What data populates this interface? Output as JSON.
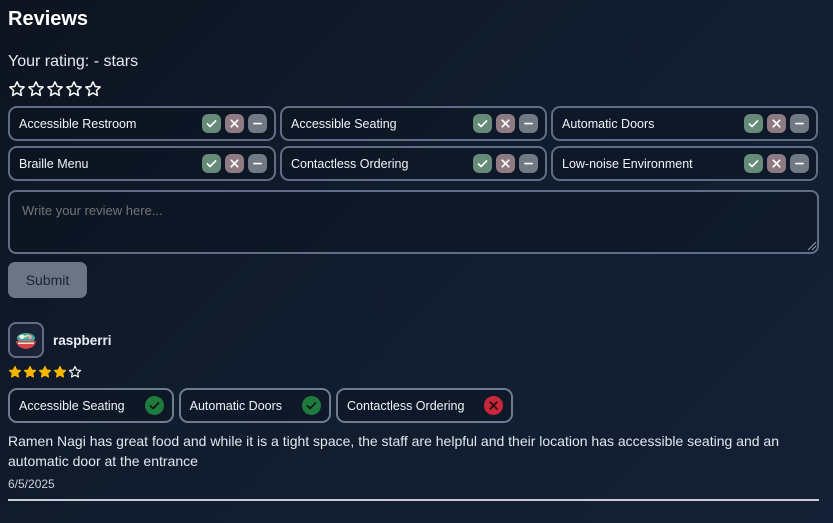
{
  "page": {
    "title": "Reviews"
  },
  "rating": {
    "label": "Your rating: - stars",
    "value": 0,
    "max": 5
  },
  "features": [
    {
      "label": "Accessible Restroom"
    },
    {
      "label": "Accessible Seating"
    },
    {
      "label": "Automatic Doors"
    },
    {
      "label": "Braille Menu"
    },
    {
      "label": "Contactless Ordering"
    },
    {
      "label": "Low-noise Environment"
    }
  ],
  "review_input": {
    "placeholder": "Write your review here...",
    "value": ""
  },
  "submit": {
    "label": "Submit"
  },
  "review": {
    "username": "raspberri",
    "rating": 4,
    "max_rating": 5,
    "tags": [
      {
        "label": "Accessible Seating",
        "status": "positive"
      },
      {
        "label": "Automatic Doors",
        "status": "positive"
      },
      {
        "label": "Contactless Ordering",
        "status": "negative"
      }
    ],
    "text": "Ramen Nagi has great food and while it is a tight space, the staff are helpful and their location has accessible seating and an automatic door at the entrance",
    "date": "6/5/2025"
  },
  "colors": {
    "star_filled": "#f5b500",
    "star_outline": "#ffffff",
    "positive": "#1f7a3d",
    "negative": "#c8283a"
  },
  "icons": {
    "star": "star-icon",
    "check": "check-icon",
    "cross": "x-icon",
    "minus": "minus-icon",
    "avatar": "ramen-bowl-avatar-icon"
  }
}
